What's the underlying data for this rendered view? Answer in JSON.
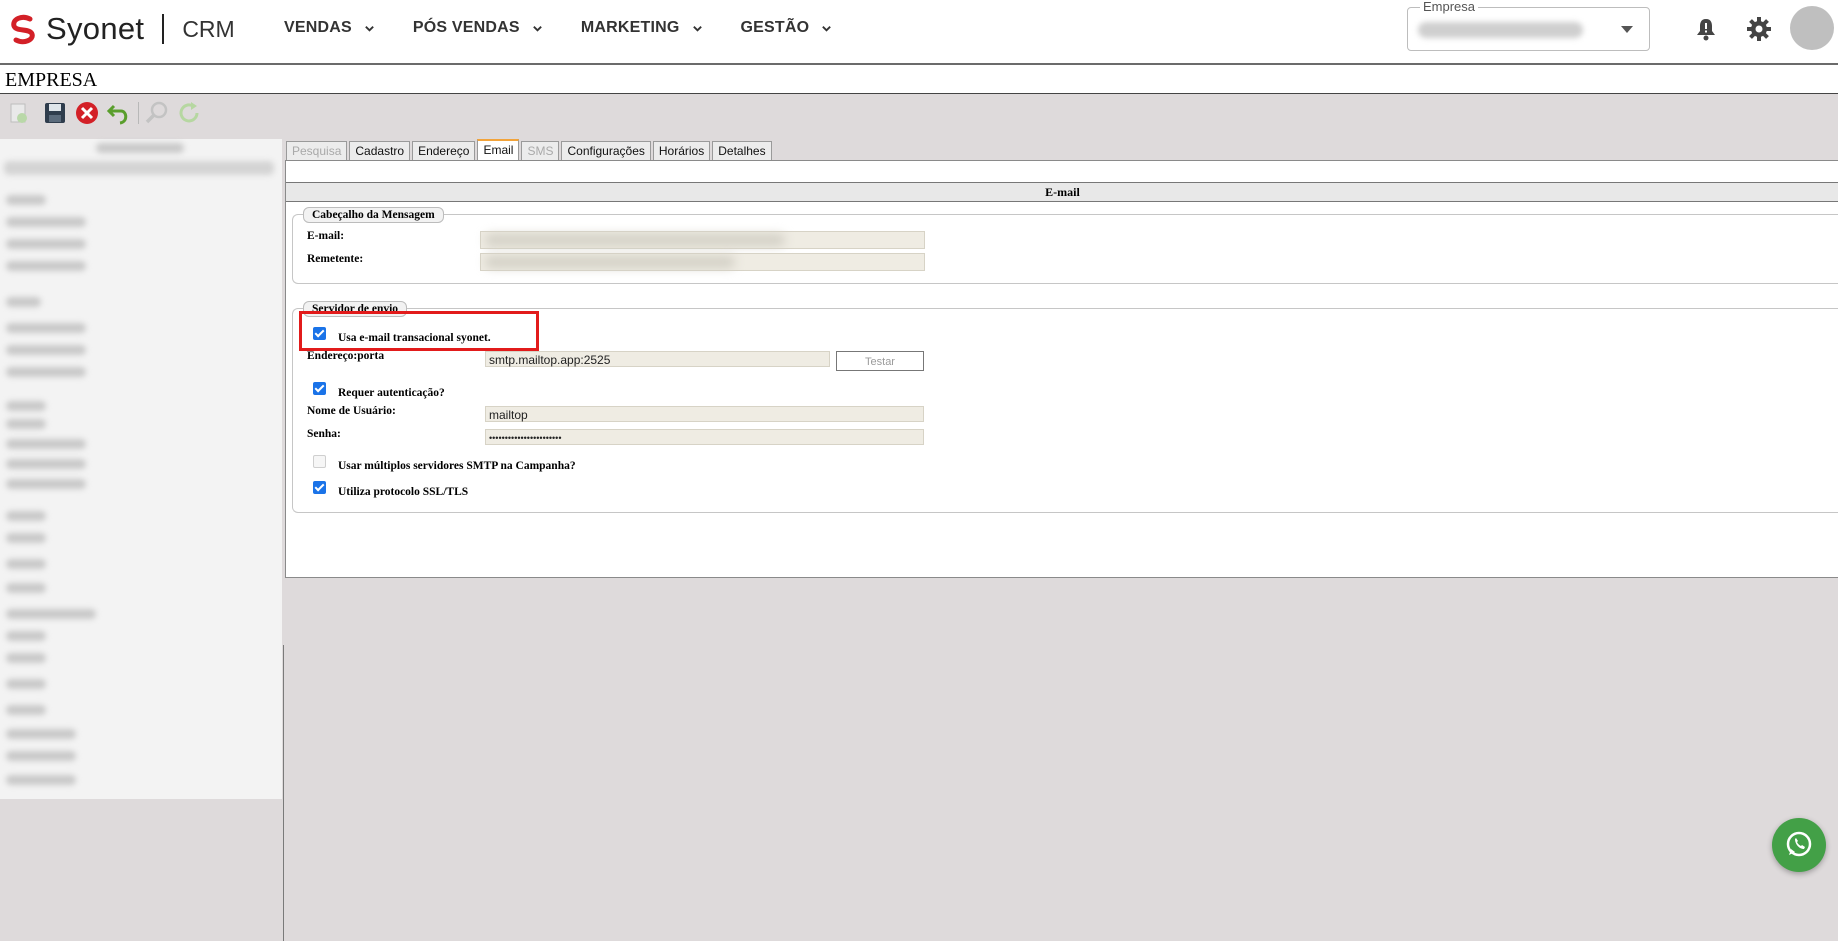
{
  "header": {
    "logo_text": "Syonet",
    "product": "CRM",
    "nav": [
      {
        "label": "VENDAS"
      },
      {
        "label": "PÓS VENDAS"
      },
      {
        "label": "MARKETING"
      },
      {
        "label": "GESTÃO"
      }
    ],
    "empresa_label": "Empresa",
    "icons": [
      "notification-bell-icon",
      "gear-icon",
      "avatar"
    ]
  },
  "page": {
    "title": "EMPRESA"
  },
  "toolbar": {
    "icons": [
      "new-record-icon",
      "save-icon",
      "delete-icon",
      "undo-icon",
      "search-icon",
      "refresh-icon"
    ]
  },
  "tabs": [
    {
      "label": "Pesquisa",
      "state": "disabled"
    },
    {
      "label": "Cadastro",
      "state": "normal"
    },
    {
      "label": "Endereço",
      "state": "normal"
    },
    {
      "label": "Email",
      "state": "active"
    },
    {
      "label": "SMS",
      "state": "disabled"
    },
    {
      "label": "Configurações",
      "state": "normal"
    },
    {
      "label": "Horários",
      "state": "normal"
    },
    {
      "label": "Detalhes",
      "state": "normal"
    }
  ],
  "email_section": {
    "title": "E-mail",
    "header_group": {
      "legend": "Cabeçalho da Mensagem",
      "email_label": "E-mail:",
      "remetente_label": "Remetente:"
    },
    "server_group": {
      "legend": "Servidor de envio",
      "transacional_label": "Usa e-mail transacional syonet.",
      "transacional_checked": true,
      "endereco_label": "Endereço:porta",
      "endereco_value": "smtp.mailtop.app:2525",
      "testar_label": "Testar",
      "auth_label": "Requer autenticação?",
      "auth_checked": true,
      "usuario_label": "Nome de Usuário:",
      "usuario_value": "mailtop",
      "senha_label": "Senha:",
      "senha_value": "•••••••••••••••••••••••",
      "multi_smtp_label": "Usar múltiplos servidores SMTP na Campanha?",
      "multi_smtp_checked": false,
      "ssl_label": "Utiliza protocolo SSL/TLS",
      "ssl_checked": true
    }
  },
  "colors": {
    "brand_red": "#d32027",
    "checkbox_blue": "#1a73e8",
    "highlight_red": "#e21b1b",
    "whatsapp_green": "#43a047",
    "active_tab_accent": "#f2a33a"
  }
}
